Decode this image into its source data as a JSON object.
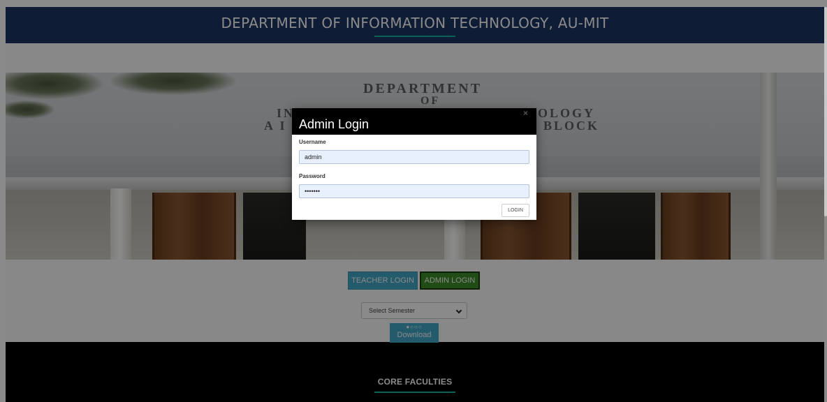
{
  "header": {
    "title": "DEPARTMENT OF INFORMATION TECHNOLOGY, AU-MIT"
  },
  "hero": {
    "sign_lines": [
      "DEPARTMENT",
      "OF",
      "IN",
      "OLOGY",
      "A I",
      "BLOCK"
    ]
  },
  "buttons": {
    "teacher_login": "TEACHER LOGIN",
    "admin_login": "ADMIN LOGIN"
  },
  "semester_select": {
    "selected": "Select Semester"
  },
  "download": {
    "label": "Download",
    "carousel_dots": "●○○○"
  },
  "faculties": {
    "title": "CORE FACULTIES"
  },
  "modal": {
    "title": "Admin Login",
    "close_glyph": "×",
    "username_label": "Username",
    "username_value": "admin",
    "password_label": "Password",
    "password_value": "•••••••",
    "login_label": "LOGIN"
  },
  "colors": {
    "header_bg": "#1d3563",
    "accent": "#16b39b",
    "teacher_btn": "#41a9c9",
    "admin_btn": "#3e8d2a"
  }
}
